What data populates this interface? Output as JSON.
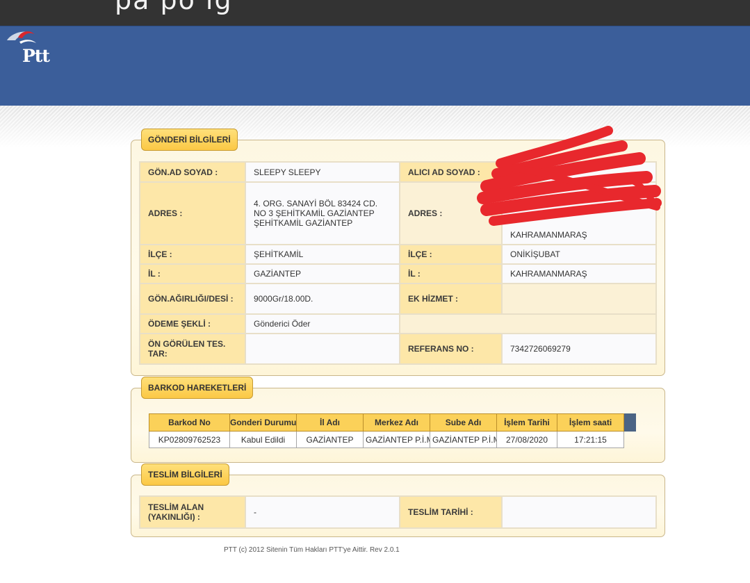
{
  "topbar": {
    "text": "pa po ig"
  },
  "logo": {
    "text": "Ptt"
  },
  "gonderi": {
    "title": "GÖNDERİ BİLGİLERİ",
    "rows": [
      {
        "l1": "GÖN.AD SOYAD :",
        "v1": "SLEEPY SLEEPY",
        "l2": "ALICI AD SOYAD :",
        "v2": ""
      },
      {
        "l1": "ADRES :",
        "v1": "4. ORG. SANAYİ BÖL 83424 CD. NO 3 ŞEHİTKAMİL GAZİANTEP ŞEHİTKAMİL GAZİANTEP",
        "l2": "ADRES :",
        "v2": "KAHRAMANMARAŞ"
      },
      {
        "l1": "İLÇE :",
        "v1": "ŞEHİTKAMİL",
        "l2": "İLÇE :",
        "v2": "ONİKİŞUBAT"
      },
      {
        "l1": "İL :",
        "v1": "GAZİANTEP",
        "l2": "İL :",
        "v2": "KAHRAMANMARAŞ"
      },
      {
        "l1": "GÖN.AĞIRLIĞI/DESİ :",
        "v1": "9000Gr/18.00D.",
        "l2": "EK HİZMET :",
        "v2": ""
      },
      {
        "l1": "ÖDEME ŞEKLİ :",
        "v1": "Gönderici Öder"
      },
      {
        "l1": "ÖN GÖRÜLEN TES. TAR:",
        "v1": "",
        "l2": "REFERANS NO :",
        "v2": "7342726069279"
      }
    ]
  },
  "barkod": {
    "title": "BARKOD HAREKETLERİ",
    "columns": [
      "Barkod No",
      "Gonderi Durumu",
      "İl Adı",
      "Merkez Adı",
      "Sube Adı",
      "İşlem Tarihi",
      "İşlem saati"
    ],
    "rows": [
      [
        "KP02809762523",
        "Kabul Edildi",
        "GAZİANTEP",
        "GAZİANTEP P.İ.M.",
        "GAZİANTEP P.İ.M.",
        "27/08/2020",
        "17:21:15"
      ]
    ]
  },
  "teslim": {
    "title": "TESLİM BİLGİLERİ",
    "l1": "TESLİM ALAN (YAKINLIĞI) :",
    "v1": "-",
    "l2": "TESLİM TARİHİ :",
    "v2": ""
  },
  "footer": {
    "text": "PTT (c) 2012 Sitenin Tüm Hakları PTT'ye Aittir. Rev 2.0.1"
  },
  "colors": {
    "header": "#3b5e9a",
    "topbar": "#333333",
    "tab": "#fbd159",
    "label_bg": "#fde7a8",
    "redaction": "#e8282d"
  }
}
